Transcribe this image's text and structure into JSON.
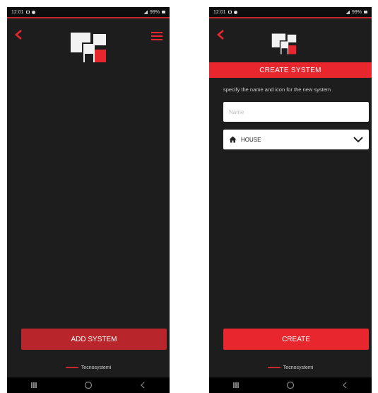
{
  "status_bar": {
    "time": "12:01",
    "battery": "99%"
  },
  "left_screen": {
    "add_button_label": "ADD SYSTEM",
    "brand": "Tecnosystemi"
  },
  "right_screen": {
    "banner_title": "CREATE SYSTEM",
    "instruction": "specify the name and icon for the new system",
    "name_placeholder": "Name",
    "icon_select": {
      "icon": "house-icon",
      "value": "HOUSE"
    },
    "create_button_label": "CREATE",
    "brand": "Tecnosystemi"
  },
  "colors": {
    "accent": "#e8262d",
    "background": "#1d1d1d",
    "statusbar": "#0d0d0d"
  }
}
